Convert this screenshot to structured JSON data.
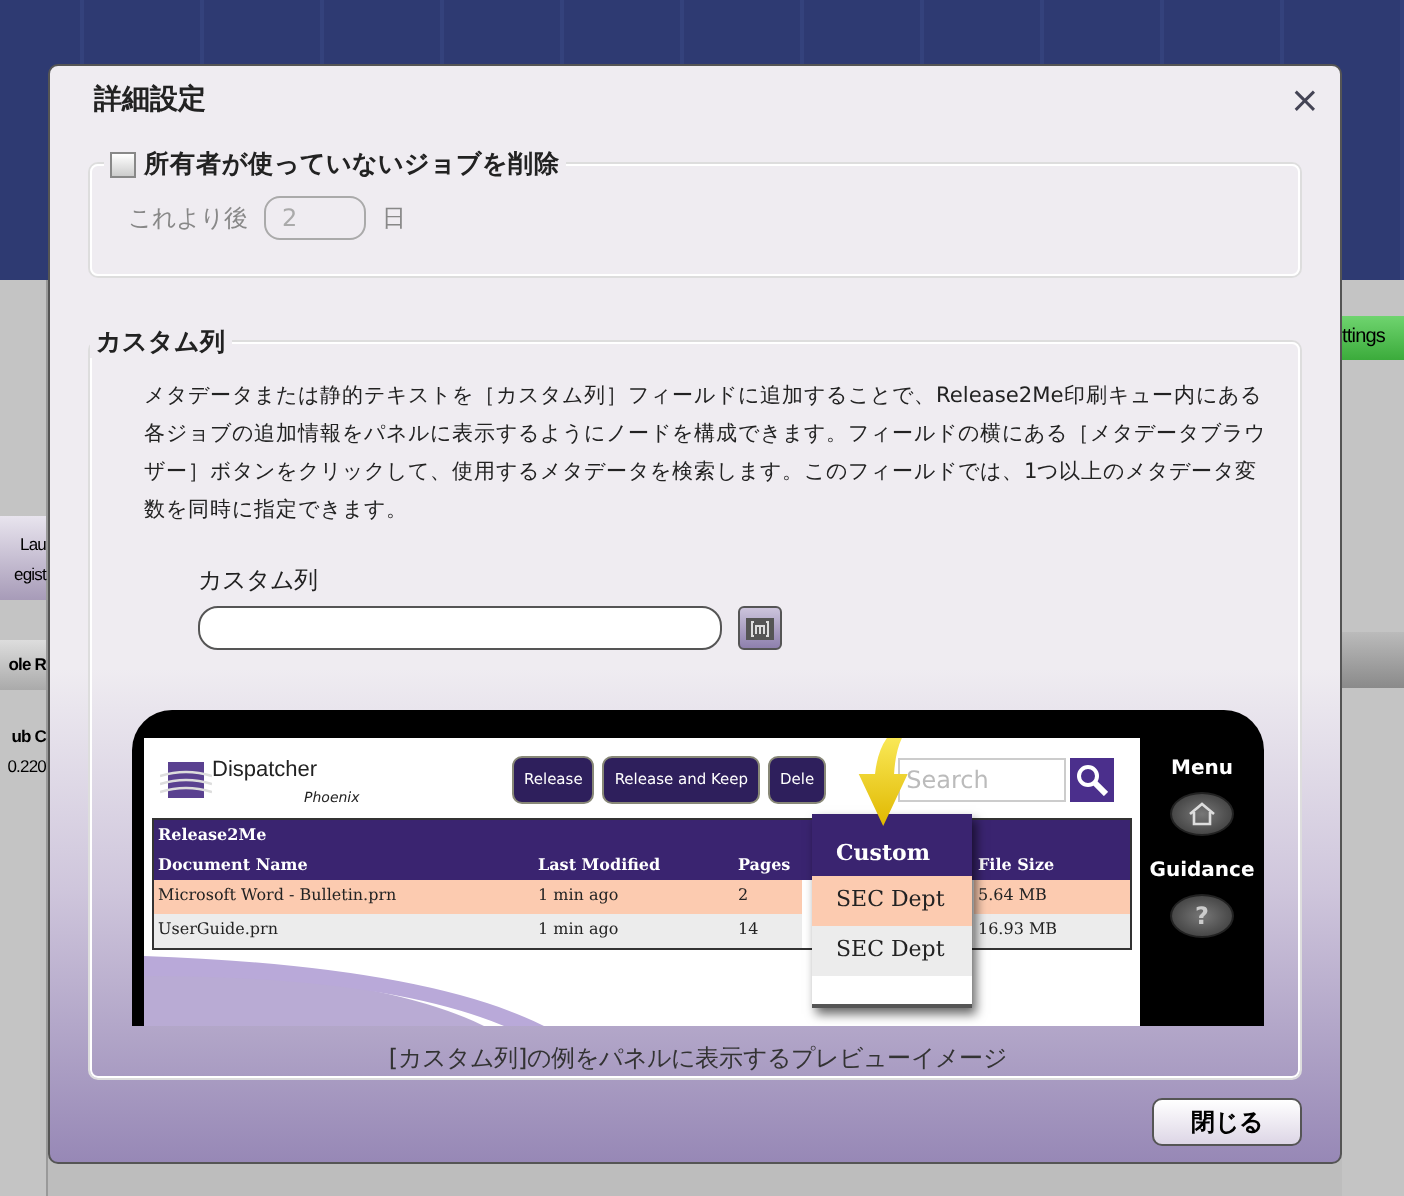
{
  "background": {
    "left_labels": [
      "Lau",
      "egist",
      "ole R",
      "ub C",
      "0.220"
    ],
    "right_label": "ttings"
  },
  "dialog": {
    "title": "詳細設定",
    "close": "×",
    "delete_jobs": {
      "label": "所有者が使っていないジョブを削除",
      "checked": false,
      "disabled": true,
      "prefix": "これより後",
      "value": "2",
      "suffix": "日"
    },
    "custom_column": {
      "legend": "カスタム列",
      "description": "メタデータまたは静的テキストを［カスタム列］フィールドに追加することで、Release2Me印刷キュー内にある各ジョブの追加情報をパネルに表示するようにノードを構成できます。フィールドの横にある［メタデータブラウザー］ボタンをクリックして、使用するメタデータを検索します。このフィールドでは、1つ以上のメタデータ変数を同時に指定できます。",
      "field_label": "カスタム列",
      "preview": {
        "logo": "Dispatcher",
        "logo_sub": "Phoenix",
        "buttons": [
          "Release",
          "Release and Keep",
          "Dele"
        ],
        "search_placeholder": "Search",
        "table": {
          "title": "Release2Me",
          "columns": [
            "Document Name",
            "Last Modified",
            "Pages",
            "File Size"
          ],
          "rows": [
            {
              "cells": [
                "Microsoft Word - Bulletin.prn",
                "1 min ago",
                "2",
                "5.64 MB"
              ],
              "selected": true
            },
            {
              "cells": [
                "UserGuide.prn",
                "1 min ago",
                "14",
                "16.93 MB"
              ],
              "selected": false
            }
          ]
        },
        "popup": {
          "header": "Custom",
          "items": [
            {
              "text": "SEC Dept",
              "selected": true
            },
            {
              "text": "SEC Dept",
              "selected": false
            }
          ]
        },
        "side": {
          "menu": "Menu",
          "guidance": "Guidance",
          "help": "?"
        }
      },
      "caption": "[カスタム列]の例をパネルに表示するプレビューイメージ"
    },
    "buttons": [
      {
        "label": "閉じる"
      }
    ]
  }
}
